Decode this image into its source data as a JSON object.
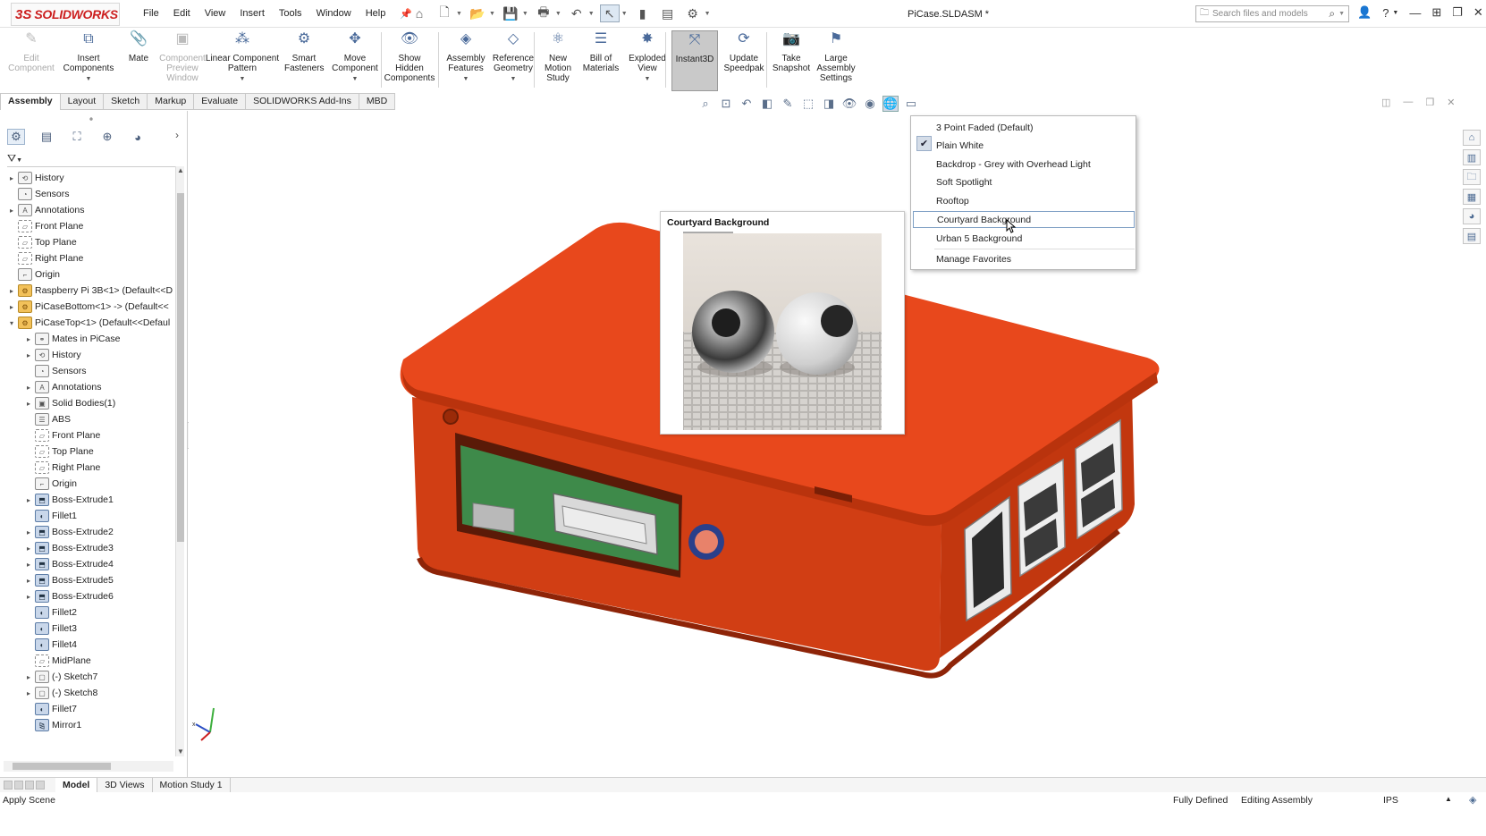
{
  "app": {
    "logo_ds": "3S",
    "logo_name": "SOLIDWORKS",
    "document_title": "PiCase.SLDASM *",
    "menus": [
      "File",
      "Edit",
      "View",
      "Insert",
      "Tools",
      "Window",
      "Help"
    ],
    "search_placeholder": "Search files and models"
  },
  "ribbon": {
    "buttons": [
      {
        "label_lines": [
          "Edit",
          "Component"
        ],
        "icon": "edit-component-icon",
        "glyph": "✎",
        "disabled": true
      },
      {
        "label_lines": [
          "Insert",
          "Components"
        ],
        "icon": "insert-components-icon",
        "glyph": "⧉",
        "dropdown": true
      },
      {
        "label_lines": [
          "Mate"
        ],
        "icon": "mate-icon",
        "glyph": "📎"
      },
      {
        "label_lines": [
          "Component",
          "Preview",
          "Window"
        ],
        "icon": "component-preview-icon",
        "glyph": "▣",
        "disabled": true
      },
      {
        "label_lines": [
          "Linear Component",
          "Pattern"
        ],
        "icon": "linear-pattern-icon",
        "glyph": "⁂",
        "dropdown": true
      },
      {
        "label_lines": [
          "Smart",
          "Fasteners"
        ],
        "icon": "smart-fasteners-icon",
        "glyph": "⚙"
      },
      {
        "label_lines": [
          "Move",
          "Component"
        ],
        "icon": "move-component-icon",
        "glyph": "✥",
        "dropdown": true
      },
      {
        "label_lines": [
          "Show",
          "Hidden",
          "Components"
        ],
        "icon": "show-hidden-icon",
        "glyph": "👁"
      },
      {
        "label_lines": [
          "Assembly",
          "Features"
        ],
        "icon": "assembly-features-icon",
        "glyph": "◈",
        "dropdown": true
      },
      {
        "label_lines": [
          "Reference",
          "Geometry"
        ],
        "icon": "reference-geometry-icon",
        "glyph": "◇",
        "dropdown": true
      },
      {
        "label_lines": [
          "New",
          "Motion",
          "Study"
        ],
        "icon": "motion-study-icon",
        "glyph": "⚛"
      },
      {
        "label_lines": [
          "Bill of",
          "Materials"
        ],
        "icon": "bom-icon",
        "glyph": "☰"
      },
      {
        "label_lines": [
          "Exploded",
          "View"
        ],
        "icon": "exploded-view-icon",
        "glyph": "✸",
        "dropdown": true
      },
      {
        "label_lines": [
          "Instant3D"
        ],
        "icon": "instant3d-icon",
        "glyph": "⤧",
        "active": true
      },
      {
        "label_lines": [
          "Update",
          "Speedpak"
        ],
        "icon": "speedpak-icon",
        "glyph": "⟳"
      },
      {
        "label_lines": [
          "Take",
          "Snapshot"
        ],
        "icon": "camera-icon",
        "glyph": "📷"
      },
      {
        "label_lines": [
          "Large",
          "Assembly",
          "Settings"
        ],
        "icon": "large-assembly-icon",
        "glyph": "⚑"
      }
    ]
  },
  "command_tabs": [
    "Assembly",
    "Layout",
    "Sketch",
    "Markup",
    "Evaluate",
    "SOLIDWORKS Add-Ins",
    "MBD"
  ],
  "tree": [
    {
      "label": "History",
      "icon": "history-icon",
      "exp": "▸",
      "indent": 0
    },
    {
      "label": "Sensors",
      "icon": "sensors-icon",
      "exp": "",
      "indent": 0
    },
    {
      "label": "Annotations",
      "icon": "annotations-icon",
      "exp": "▸",
      "indent": 0
    },
    {
      "label": "Front Plane",
      "icon": "plane-icon",
      "exp": "",
      "indent": 0
    },
    {
      "label": "Top Plane",
      "icon": "plane-icon",
      "exp": "",
      "indent": 0
    },
    {
      "label": "Right Plane",
      "icon": "plane-icon",
      "exp": "",
      "indent": 0
    },
    {
      "label": "Origin",
      "icon": "origin-icon",
      "exp": "",
      "indent": 0
    },
    {
      "label": "Raspberry Pi 3B<1> (Default<<D",
      "icon": "assembly-icon",
      "exp": "▸",
      "indent": 0
    },
    {
      "label": "PiCaseBottom<1> -> (Default<<",
      "icon": "assembly-icon",
      "exp": "▸",
      "indent": 0
    },
    {
      "label": "PiCaseTop<1> (Default<<Defaul",
      "icon": "assembly-icon",
      "exp": "▾",
      "indent": 0
    },
    {
      "label": "Mates in PiCase",
      "icon": "mates-icon",
      "exp": "▸",
      "indent": 1
    },
    {
      "label": "History",
      "icon": "history-icon",
      "exp": "▸",
      "indent": 1
    },
    {
      "label": "Sensors",
      "icon": "sensors-icon",
      "exp": "",
      "indent": 1
    },
    {
      "label": "Annotations",
      "icon": "annotations-icon",
      "exp": "▸",
      "indent": 1
    },
    {
      "label": "Solid Bodies(1)",
      "icon": "solid-bodies-icon",
      "exp": "▸",
      "indent": 1
    },
    {
      "label": "ABS",
      "icon": "material-icon",
      "exp": "",
      "indent": 1
    },
    {
      "label": "Front Plane",
      "icon": "plane-icon",
      "exp": "",
      "indent": 1
    },
    {
      "label": "Top Plane",
      "icon": "plane-icon",
      "exp": "",
      "indent": 1
    },
    {
      "label": "Right Plane",
      "icon": "plane-icon",
      "exp": "",
      "indent": 1
    },
    {
      "label": "Origin",
      "icon": "origin-icon",
      "exp": "",
      "indent": 1
    },
    {
      "label": "Boss-Extrude1",
      "icon": "extrude-icon",
      "exp": "▸",
      "indent": 1
    },
    {
      "label": "Fillet1",
      "icon": "fillet-icon",
      "exp": "",
      "indent": 1
    },
    {
      "label": "Boss-Extrude2",
      "icon": "extrude-icon",
      "exp": "▸",
      "indent": 1
    },
    {
      "label": "Boss-Extrude3",
      "icon": "extrude-icon",
      "exp": "▸",
      "indent": 1
    },
    {
      "label": "Boss-Extrude4",
      "icon": "extrude-icon",
      "exp": "▸",
      "indent": 1
    },
    {
      "label": "Boss-Extrude5",
      "icon": "extrude-icon",
      "exp": "▸",
      "indent": 1
    },
    {
      "label": "Boss-Extrude6",
      "icon": "extrude-icon",
      "exp": "▸",
      "indent": 1
    },
    {
      "label": "Fillet2",
      "icon": "fillet-icon",
      "exp": "",
      "indent": 1
    },
    {
      "label": "Fillet3",
      "icon": "fillet-icon",
      "exp": "",
      "indent": 1
    },
    {
      "label": "Fillet4",
      "icon": "fillet-icon",
      "exp": "",
      "indent": 1
    },
    {
      "label": "MidPlane",
      "icon": "plane-icon",
      "exp": "",
      "indent": 1
    },
    {
      "label": "(-) Sketch7",
      "icon": "sketch-icon",
      "exp": "▸",
      "indent": 1
    },
    {
      "label": "(-) Sketch8",
      "icon": "sketch-icon",
      "exp": "▸",
      "indent": 1
    },
    {
      "label": "Fillet7",
      "icon": "fillet-icon",
      "exp": "",
      "indent": 1
    },
    {
      "label": "Mirror1",
      "icon": "mirror-icon",
      "exp": "",
      "indent": 1
    }
  ],
  "scene_menu": {
    "items": [
      "3 Point Faded  (Default)",
      "Plain White",
      "Backdrop - Grey with Overhead Light",
      "Soft Spotlight",
      "Rooftop",
      "Courtyard Background",
      "Urban 5 Background"
    ],
    "checked_index": 1,
    "highlighted_index": 5,
    "manage": "Manage Favorites"
  },
  "preview": {
    "title": "Courtyard Background"
  },
  "bottom_tabs": [
    "Model",
    "3D Views",
    "Motion Study 1"
  ],
  "status": {
    "left": "Apply Scene",
    "state": "Fully Defined",
    "mode": "Editing Assembly",
    "units": "IPS"
  },
  "colors": {
    "case_top": "#e8481c",
    "case_side": "#d23c12",
    "case_dark": "#a82c0a",
    "brand_red": "#cc1f1f"
  }
}
